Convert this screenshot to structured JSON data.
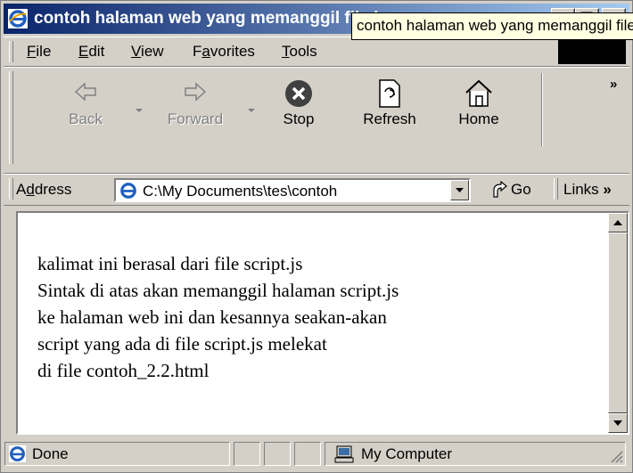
{
  "window": {
    "title": "contoh halaman web yang memanggil file jav...",
    "tooltip": "contoh halaman web yang memanggil file javascript"
  },
  "menu": {
    "file": {
      "pre": "",
      "key": "F",
      "post": "ile"
    },
    "edit": {
      "pre": "",
      "key": "E",
      "post": "dit"
    },
    "view": {
      "pre": "",
      "key": "V",
      "post": "iew"
    },
    "favorites": {
      "pre": "F",
      "key": "a",
      "post": "vorites"
    },
    "tools": {
      "pre": "",
      "key": "T",
      "post": "ools"
    }
  },
  "toolbar": {
    "back": "Back",
    "forward": "Forward",
    "stop": "Stop",
    "refresh": "Refresh",
    "home": "Home",
    "more": "»"
  },
  "address": {
    "label_pre": "A",
    "label_key": "d",
    "label_post": "dress",
    "value": "C:\\My Documents\\tes\\contoh",
    "go": "Go",
    "links": "Links",
    "links_more": "»"
  },
  "page": {
    "lines": [
      "kalimat ini berasal dari file script.js",
      "Sintak di atas akan memanggil halaman script.js",
      "ke halaman web ini dan kesannya seakan-akan",
      "script yang ada di file script.js melekat",
      "di file contoh_2.2.html"
    ]
  },
  "status": {
    "text": "Done",
    "zone": "My Computer"
  },
  "colors": {
    "titlebar_start": "#0a246a",
    "titlebar_end": "#a6caf0",
    "chrome": "#d4d0c8",
    "tooltip_bg": "#ffffe1"
  }
}
